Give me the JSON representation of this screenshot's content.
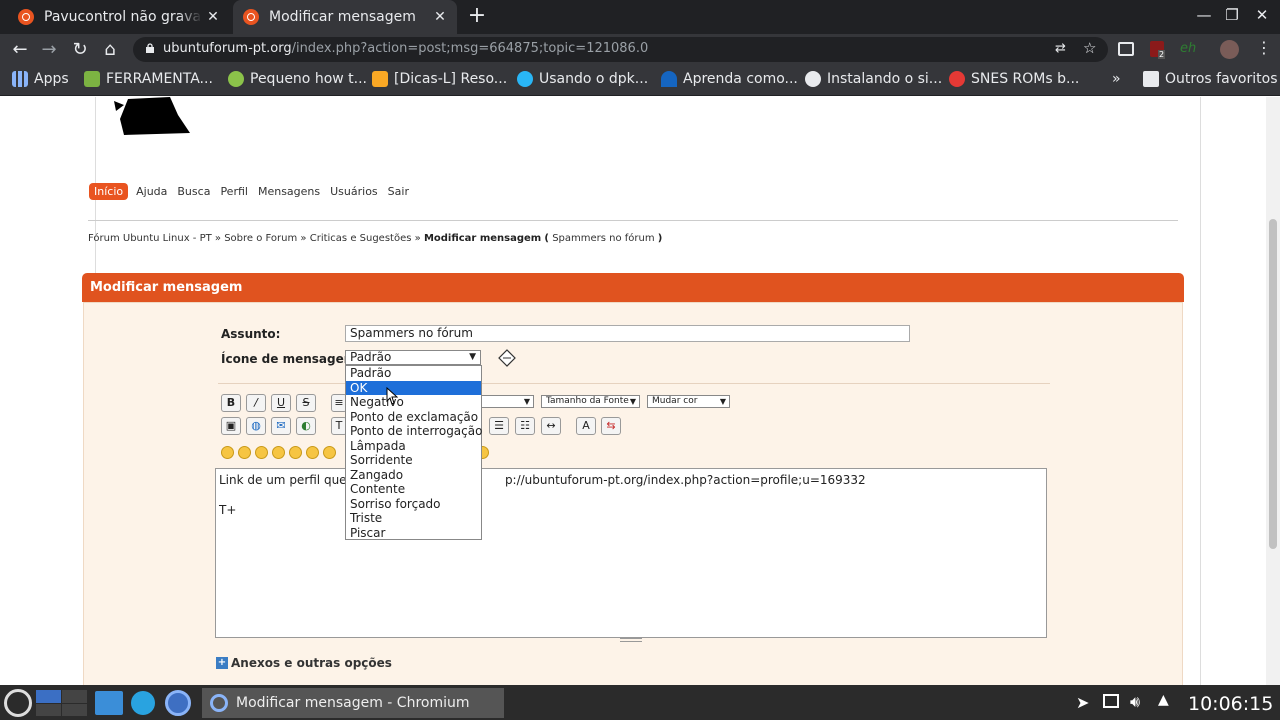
{
  "browser": {
    "tabs": [
      {
        "title": "Pavucontrol não grava mi",
        "active": false
      },
      {
        "title": "Modificar mensagem",
        "active": true
      }
    ],
    "url_host": "ubuntuforum-pt.org",
    "url_path": "/index.php?action=post;msg=664875;topic=121086.0",
    "extension_badge": "2",
    "extension_label": "eh",
    "bookmarks": [
      {
        "label": "Apps",
        "icon": "apps-grid-icon"
      },
      {
        "label": "FERRAMENTA...",
        "icon": "tool-icon"
      },
      {
        "label": "Pequeno how t...",
        "icon": "howto-icon"
      },
      {
        "label": "[Dicas-L] Reso...",
        "icon": "dicas-icon"
      },
      {
        "label": "Usando o dpk...",
        "icon": "dpkg-icon"
      },
      {
        "label": "Aprenda como...",
        "icon": "learn-icon"
      },
      {
        "label": "Instalando o si...",
        "icon": "wordpress-icon"
      },
      {
        "label": "SNES ROMs b...",
        "icon": "snes-icon"
      }
    ],
    "more_bookmarks": "»",
    "other_bookmarks": "Outros favoritos"
  },
  "forum": {
    "menu": [
      "Início",
      "Ajuda",
      "Busca",
      "Perfil",
      "Mensagens",
      "Usuários",
      "Sair"
    ],
    "breadcrumb": {
      "items": [
        "Fórum Ubuntu Linux - PT",
        "Sobre o Forum",
        "Criticas e Sugestões"
      ],
      "current": "Modificar mensagem",
      "topic": "Spammers no fórum"
    },
    "section_title": "Modificar mensagem",
    "subject_label": "Assunto:",
    "subject_value": "Spammers no fórum",
    "icon_label": "Ícone de mensagem:",
    "icon_selected": "Padrão",
    "icon_options": [
      "Padrão",
      "OK",
      "Negativo",
      "Ponto de exclamação",
      "Ponto de interrogação",
      "Lâmpada",
      "Sorridente",
      "Zangado",
      "Contente",
      "Sorriso forçado",
      "Triste",
      "Piscar"
    ],
    "highlighted_option": "OK",
    "font_size_label": "Tamanho da Fonte",
    "color_label": "Mudar cor",
    "message_line1_start": "Link de um perfil que pr",
    "message_line1_end": "p://ubuntuforum-pt.org/index.php?action=profile;u=169332",
    "message_line2": "T+",
    "attachments_label": "Anexos e outras opções"
  },
  "taskbar": {
    "window_title": "Modificar mensagem - Chromium",
    "clock": "10:06:15"
  }
}
